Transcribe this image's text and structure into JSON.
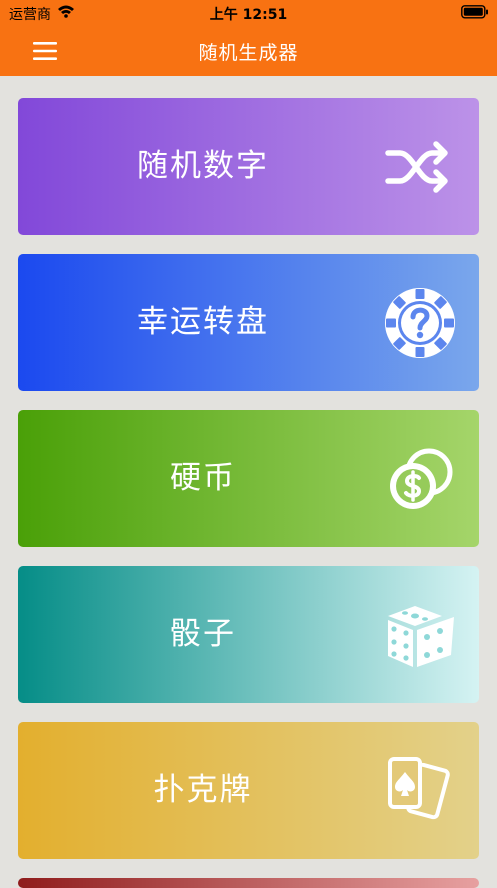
{
  "status": {
    "carrier": "运营商",
    "time": "上午 12:51"
  },
  "nav": {
    "title": "随机生成器"
  },
  "cards": [
    {
      "label": "随机数字",
      "icon": "shuffle-icon"
    },
    {
      "label": "幸运转盘",
      "icon": "wheel-question-icon"
    },
    {
      "label": "硬币",
      "icon": "coin-icon"
    },
    {
      "label": "骰子",
      "icon": "dice-icon"
    },
    {
      "label": "扑克牌",
      "icon": "playing-cards-icon"
    }
  ],
  "colors": {
    "brand": "#f87212",
    "background": "#e3e2de",
    "card_random_number": [
      "#8248d9",
      "#bc92e8"
    ],
    "card_lucky_wheel": [
      "#1b49ef",
      "#7aa7ec"
    ],
    "card_coin": [
      "#4aa008",
      "#a5d56a"
    ],
    "card_dice": [
      "#058d87",
      "#d5f3f3"
    ],
    "card_poker": [
      "#e3af2e",
      "#e3d18a"
    ],
    "card_partial": [
      "#8f1c1c",
      "#e7a0a0"
    ]
  }
}
